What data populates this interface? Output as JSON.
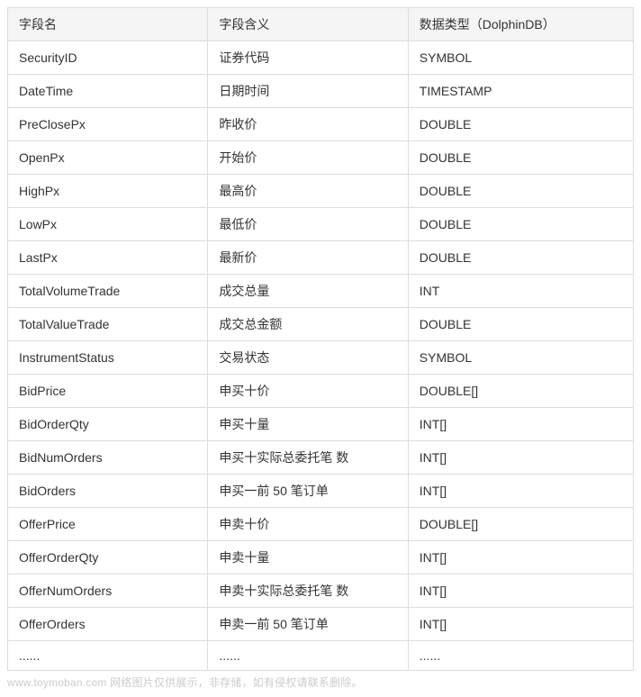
{
  "table": {
    "headers": [
      "字段名",
      "字段含义",
      "数据类型（DolphinDB）"
    ],
    "rows": [
      [
        "SecurityID",
        "证券代码",
        "SYMBOL"
      ],
      [
        "DateTime",
        "日期时间",
        "TIMESTAMP"
      ],
      [
        "PreClosePx",
        "昨收价",
        "DOUBLE"
      ],
      [
        "OpenPx",
        "开始价",
        "DOUBLE"
      ],
      [
        "HighPx",
        "最高价",
        "DOUBLE"
      ],
      [
        "LowPx",
        "最低价",
        "DOUBLE"
      ],
      [
        "LastPx",
        "最新价",
        "DOUBLE"
      ],
      [
        "TotalVolumeTrade",
        "成交总量",
        "INT"
      ],
      [
        "TotalValueTrade",
        "成交总金额",
        "DOUBLE"
      ],
      [
        "InstrumentStatus",
        "交易状态",
        "SYMBOL"
      ],
      [
        "BidPrice",
        "申买十价",
        "DOUBLE[]"
      ],
      [
        "BidOrderQty",
        "申买十量",
        "INT[]"
      ],
      [
        "BidNumOrders",
        "申买十实际总委托笔 数",
        "INT[]"
      ],
      [
        "BidOrders",
        "申买一前 50 笔订单",
        "INT[]"
      ],
      [
        "OfferPrice",
        "申卖十价",
        "DOUBLE[]"
      ],
      [
        "OfferOrderQty",
        "申卖十量",
        "INT[]"
      ],
      [
        "OfferNumOrders",
        "申卖十实际总委托笔 数",
        "INT[]"
      ],
      [
        "OfferOrders",
        "申卖一前 50 笔订单",
        "INT[]"
      ],
      [
        "......",
        "......",
        "......"
      ]
    ]
  },
  "footer": {
    "text": "www.toymoban.com 网络图片仅供展示，非存储，如有侵权请联系删除。"
  }
}
